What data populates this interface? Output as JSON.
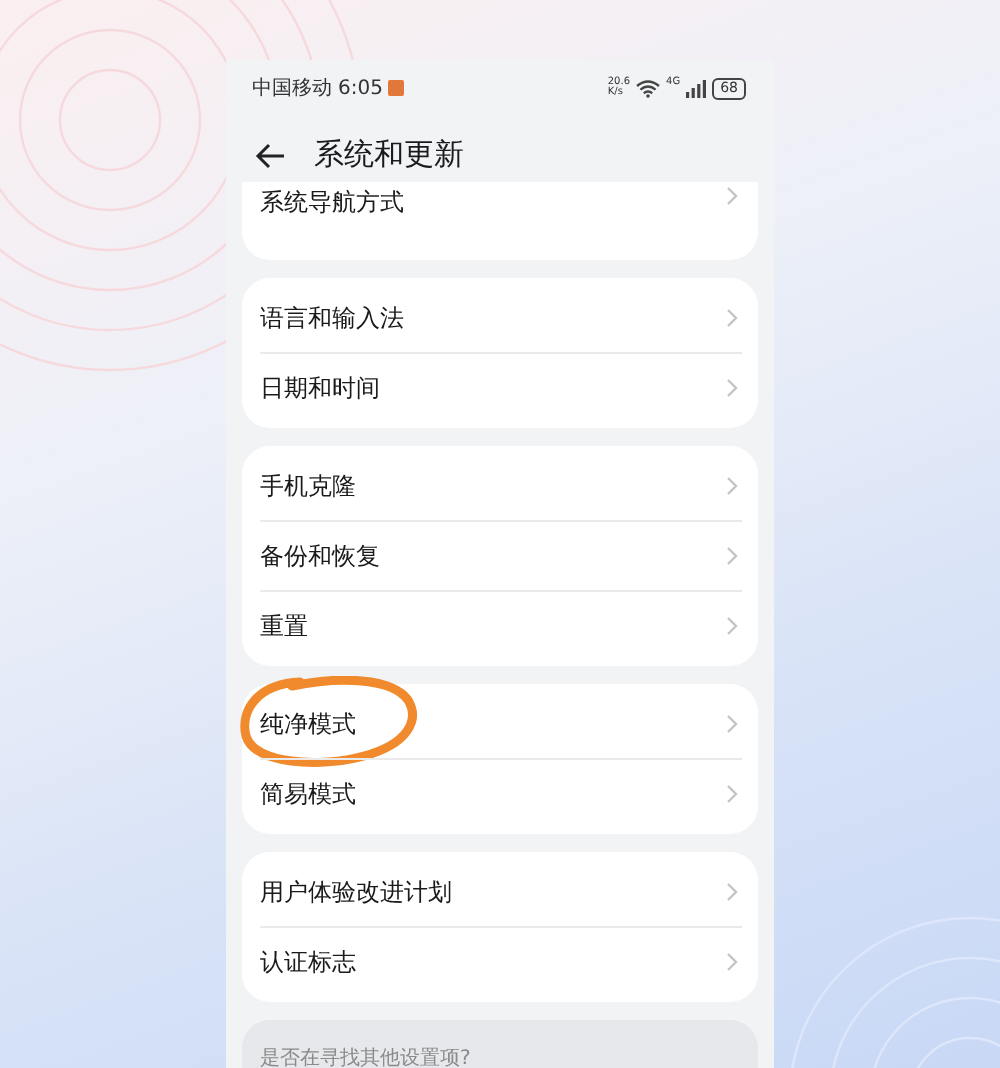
{
  "status_bar": {
    "carrier": "中国移动",
    "time": "6:05",
    "net_speed": "20.6",
    "net_speed_unit": "K/s",
    "network": "4G",
    "battery": "68"
  },
  "header": {
    "title": "系统和更新"
  },
  "groups": [
    {
      "items": [
        {
          "label": "系统导航方式",
          "circled": false
        }
      ]
    },
    {
      "items": [
        {
          "label": "语言和输入法",
          "circled": false
        },
        {
          "label": "日期和时间",
          "circled": false
        }
      ]
    },
    {
      "items": [
        {
          "label": "手机克隆",
          "circled": false
        },
        {
          "label": "备份和恢复",
          "circled": false
        },
        {
          "label": "重置",
          "circled": false
        }
      ]
    },
    {
      "items": [
        {
          "label": "纯净模式",
          "circled": true
        },
        {
          "label": "简易模式",
          "circled": false
        }
      ]
    },
    {
      "items": [
        {
          "label": "用户体验改进计划",
          "circled": false
        },
        {
          "label": "认证标志",
          "circled": false
        }
      ]
    }
  ],
  "hint": "是否在寻找其他设置项?"
}
